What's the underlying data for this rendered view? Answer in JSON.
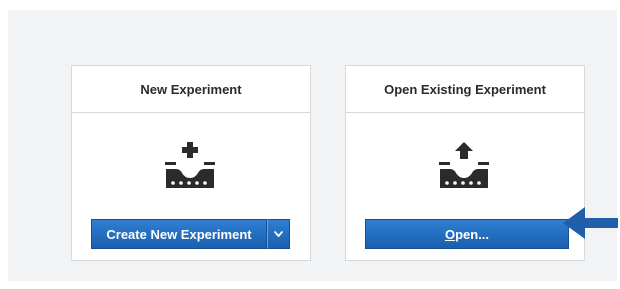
{
  "new_experiment": {
    "title": "New Experiment",
    "button_label": "Create New Experiment",
    "dropdown_icon": "chevron-down-icon",
    "icon": "add-experiment-icon"
  },
  "open_existing": {
    "title": "Open Existing Experiment",
    "button_label_underlined": "O",
    "button_label_rest": "pen...",
    "icon": "upload-experiment-icon"
  },
  "annotation": {
    "icon": "arrow-left-icon",
    "color": "#1f5fa8"
  },
  "colors": {
    "button": "#2270c3",
    "panel_bg": "#f2f3f4",
    "card_border": "#d6d9dc"
  }
}
